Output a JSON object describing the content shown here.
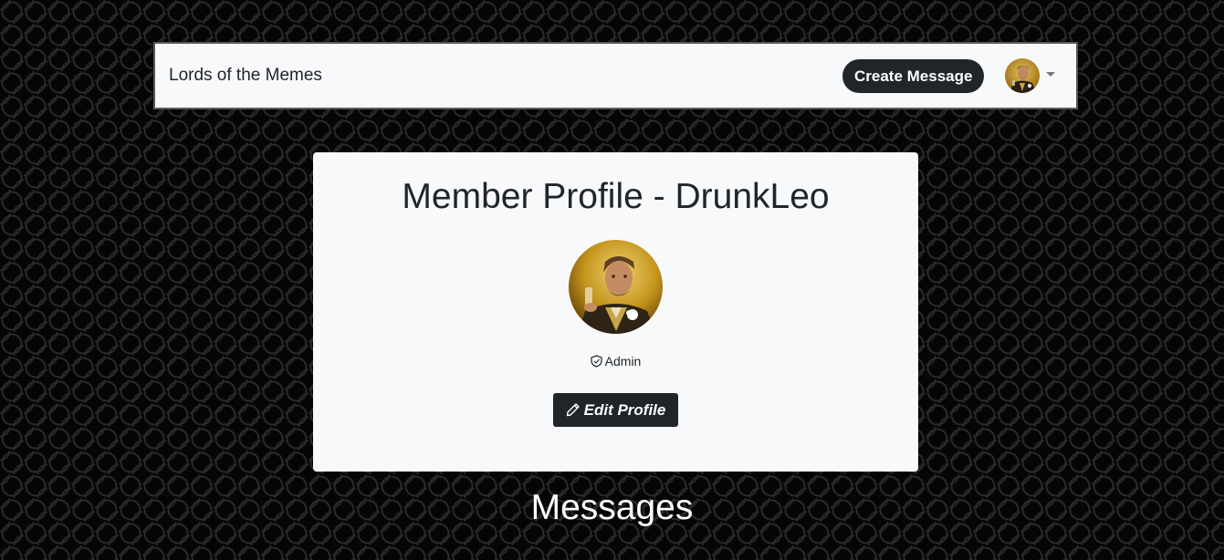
{
  "navbar": {
    "brand": "Lords of the Memes",
    "create_message_label": "Create Message",
    "avatar_icon": "user-avatar-icon",
    "dropdown_icon": "caret-down-icon"
  },
  "profile": {
    "title": "Member Profile - DrunkLeo",
    "role_icon": "shield-icon",
    "role": "Admin",
    "edit_icon": "pencil-icon",
    "edit_label": "Edit Profile"
  },
  "messages": {
    "heading": "Messages"
  },
  "colors": {
    "background": "#050505",
    "panel": "#f8f9fa",
    "dark_button": "#212529",
    "text": "#212529"
  }
}
